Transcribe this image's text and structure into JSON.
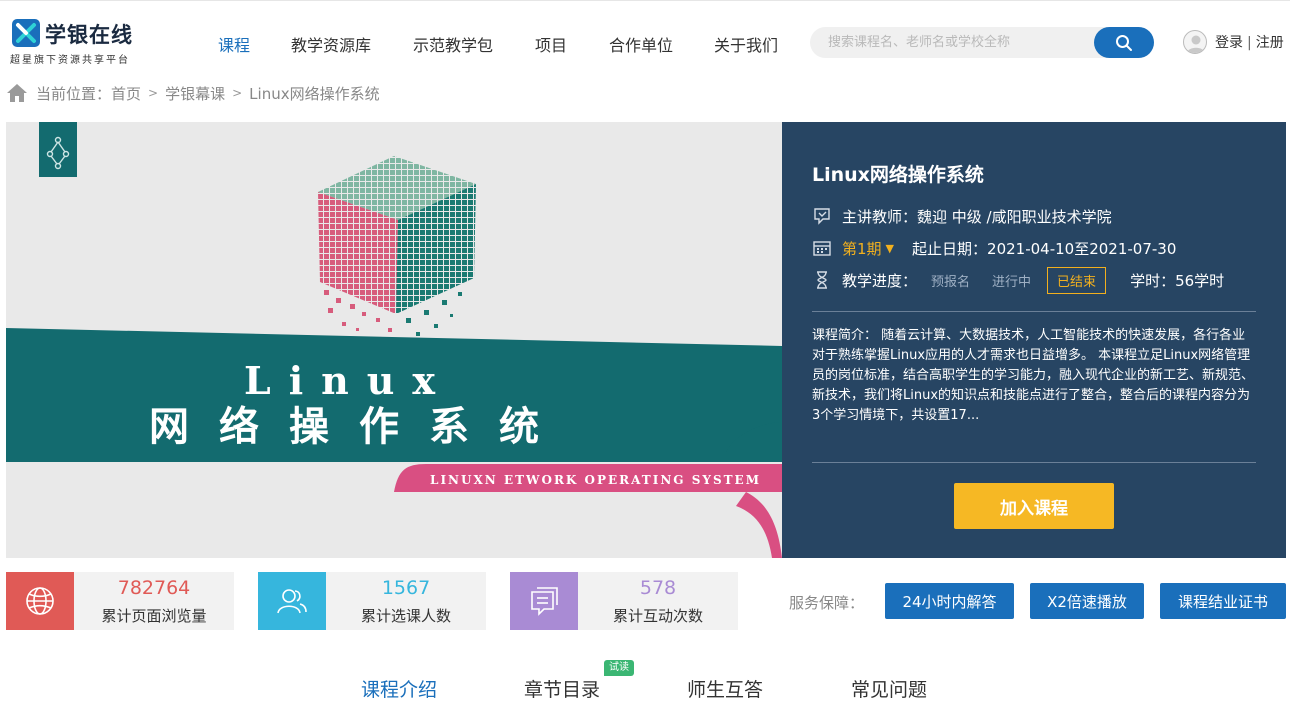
{
  "brand": {
    "name": "学银在线",
    "tagline": "超星旗下资源共享平台",
    "color": "#1a6fbb"
  },
  "nav": {
    "items": [
      {
        "label": "课程",
        "active": true
      },
      {
        "label": "教学资源库",
        "active": false
      },
      {
        "label": "示范教学包",
        "active": false
      },
      {
        "label": "项目",
        "active": false
      },
      {
        "label": "合作单位",
        "active": false
      },
      {
        "label": "关于我们",
        "active": false
      }
    ]
  },
  "search": {
    "placeholder": "搜索课程名、老师名或学校全称",
    "icon": "search-icon"
  },
  "user": {
    "login": "登录",
    "separator": "|",
    "register": "注册",
    "icon": "user-avatar-icon"
  },
  "breadcrumb": {
    "prefix": "当前位置：",
    "items": [
      "首页",
      "学银幕课",
      "Linux网络操作系统"
    ],
    "separator": ">"
  },
  "banner": {
    "title_en": "Linux",
    "title_cn": "网络操作系统",
    "subtitle": "LINUXN ETWORK OPERATING SYSTEM",
    "colors": {
      "teal": "#136b6f",
      "pink": "#d94f82",
      "background": "#e9e9e9"
    }
  },
  "course": {
    "title": "Linux网络操作系统",
    "teacher_label": "主讲教师：",
    "teacher": "魏迎 中级 /咸阳职业技术学院",
    "term": "第1期",
    "date_label": "起止日期：",
    "date_range": "2021-04-10至2021-07-30",
    "progress_label": "教学进度：",
    "progress_steps": [
      "预报名",
      "进行中",
      "已结束"
    ],
    "progress_current": "已结束",
    "hours_label": "学时：",
    "hours": "56学时",
    "description": "课程简介： 随着云计算、大数据技术，人工智能技术的快速发展，各行各业对于熟练掌握Linux应用的人才需求也日益增多。 本课程立足Linux网络管理员的岗位标准，结合高职学生的学习能力，融入现代企业的新工艺、新规范、新技术，我们将Linux的知识点和技能点进行了整合，整合后的课程内容分为3个学习情境下，共设置17...",
    "join_label": "加入课程",
    "panel_color": "#274563",
    "accent_color": "#f6b824"
  },
  "stats": [
    {
      "value": "782764",
      "label": "累计页面浏览量",
      "color": "#e05a56",
      "icon": "globe-icon"
    },
    {
      "value": "1567",
      "label": "累计选课人数",
      "color": "#36b6dd",
      "icon": "users-icon"
    },
    {
      "value": "578",
      "label": "累计互动次数",
      "color": "#a98bd4",
      "icon": "chat-icon"
    }
  ],
  "service": {
    "label": "服务保障：",
    "buttons": [
      "24小时内解答",
      "X2倍速播放",
      "课程结业证书"
    ]
  },
  "tabs": {
    "items": [
      "课程介绍",
      "章节目录",
      "师生互答",
      "常见问题"
    ],
    "active": "课程介绍",
    "badge": "试读",
    "badge_color": "#3bb673"
  }
}
